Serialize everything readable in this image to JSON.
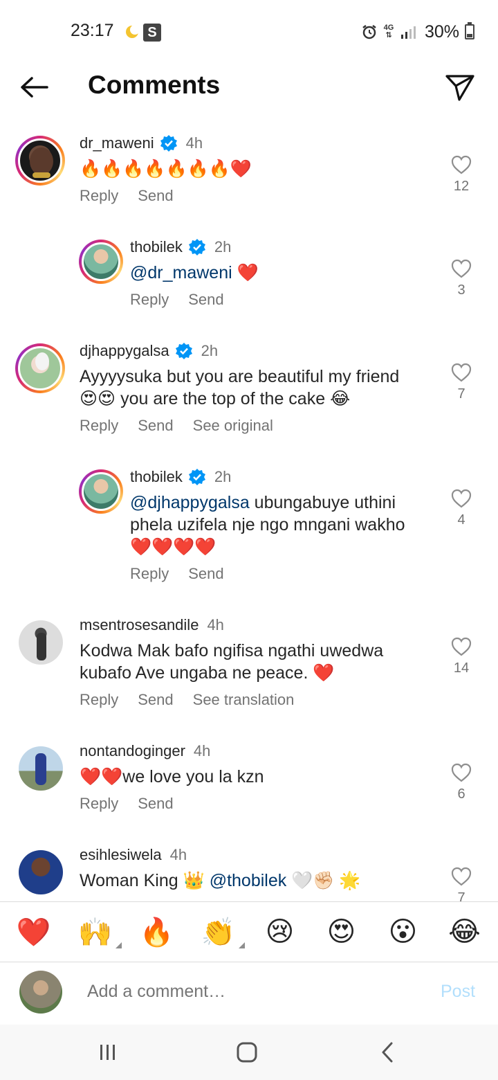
{
  "status_bar": {
    "time": "23:17",
    "s_badge": "S",
    "network": "4G",
    "battery_text": "30%",
    "battery_level": 0.3
  },
  "header": {
    "title": "Comments"
  },
  "comments": [
    {
      "username": "dr_maweni",
      "verified": true,
      "time": "4h",
      "text": "",
      "emojis": "🔥🔥🔥🔥🔥🔥🔥❤️",
      "actions": [
        "Reply",
        "Send"
      ],
      "likes": "12"
    },
    {
      "username": "thobilek",
      "verified": true,
      "time": "2h",
      "mention": "@dr_maweni",
      "text": " ",
      "emojis": "❤️",
      "actions": [
        "Reply",
        "Send"
      ],
      "likes": "3"
    },
    {
      "username": "djhappygalsa",
      "verified": true,
      "time": "2h",
      "text": "Ayyyysuka but you are beautiful my friend",
      "emojis": "😍😍",
      "text2": " you are the top of the cake ",
      "emojis2": "😂",
      "actions": [
        "Reply",
        "Send",
        "See original"
      ],
      "likes": "7"
    },
    {
      "username": "thobilek",
      "verified": true,
      "time": "2h",
      "mention": "@djhappygalsa",
      "text": " ubungabuye uthini phela uzifela nje ngo mngani wakho",
      "emojis": "❤️❤️❤️❤️",
      "actions": [
        "Reply",
        "Send"
      ],
      "likes": "4"
    },
    {
      "username": "msentrosesandile",
      "verified": false,
      "time": "4h",
      "text": "Kodwa Mak bafo ngifisa ngathi uwedwa kubafo Ave ungaba ne peace. ",
      "emojis": "❤️",
      "actions": [
        "Reply",
        "Send",
        "See translation"
      ],
      "likes": "14"
    },
    {
      "username": "nontandoginger",
      "verified": false,
      "time": "4h",
      "emojis": "❤️❤️",
      "text": "we love you la kzn",
      "actions": [
        "Reply",
        "Send"
      ],
      "likes": "6"
    },
    {
      "username": "esihlesiwela",
      "verified": false,
      "time": "4h",
      "text": "Woman King ",
      "emojis": "👑",
      "mention": "@thobilek",
      "emojis2": "🤍✊🏻 🌟",
      "actions": [],
      "likes": "7"
    }
  ],
  "reactions": [
    "❤️",
    "🙌",
    "🔥",
    "👏",
    "😢",
    "😍",
    "😮",
    "😂"
  ],
  "compose": {
    "placeholder": "Add a comment…",
    "post_label": "Post"
  },
  "colors": {
    "verified_blue": "#0095f6",
    "post_disabled": "#b2dffc",
    "mention": "#00376b"
  }
}
